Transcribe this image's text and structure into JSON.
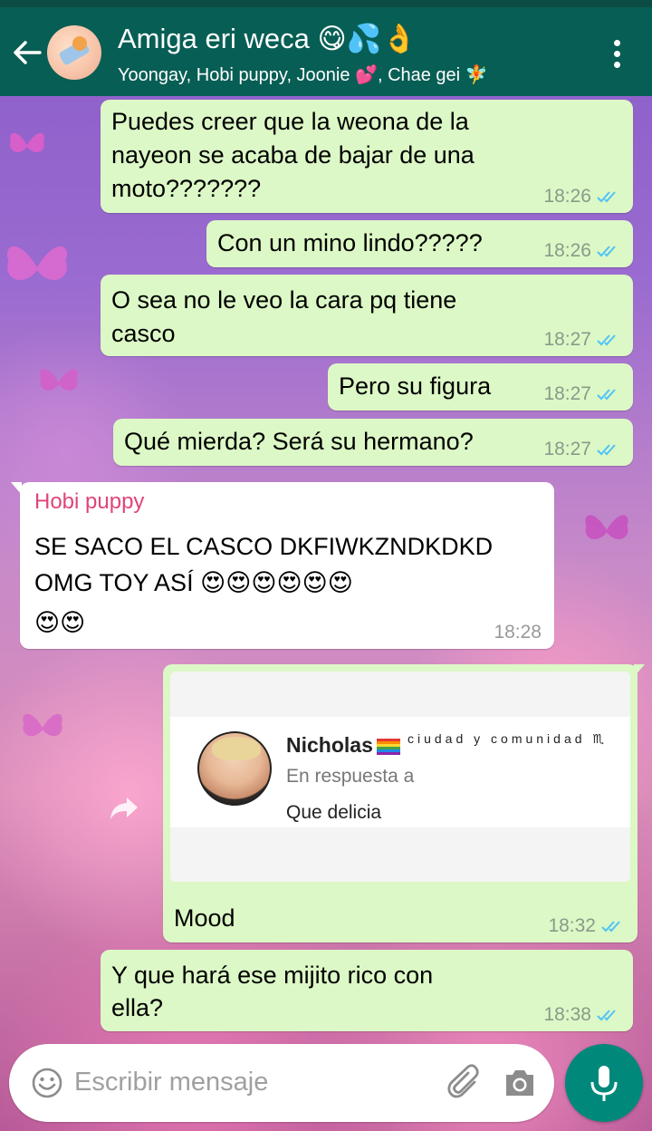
{
  "header": {
    "title": "Amiga eri weca 😋💦👌",
    "subtitle": "Yoongay, Hobi puppy, Joonie 💕, Chae gei 🧚"
  },
  "messages": [
    {
      "text": "Puedes creer que la weona de la",
      "text2": "nayeon se acaba de bajar de una",
      "text3": "moto???????",
      "time": "18:26"
    },
    {
      "text": "Con un mino lindo?????",
      "time": "18:26"
    },
    {
      "text": "O sea no le veo la cara pq tiene",
      "text2": "casco",
      "time": "18:27"
    },
    {
      "text": "Pero su figura",
      "time": "18:27"
    },
    {
      "text": "Qué mierda? Será su hermano?",
      "time": "18:27"
    },
    {
      "sender": "Hobi puppy",
      "text": "SE SACO EL CASCO DKFIWKZNDKDKD",
      "text2": "OMG TOY ASÍ 😍😍😍😍😍😍",
      "text3": "😍😍",
      "time": "18:28"
    },
    {
      "text": "Mood",
      "time": "18:32",
      "image": {
        "name": "Nicholas",
        "extra": "ciudad y comunidad ♏",
        "reply_label": "En respuesta a",
        "reply_text": "Que delicia"
      }
    },
    {
      "text": "Y que hará ese mijito rico con",
      "text2": "ella?",
      "time": "18:38"
    }
  ],
  "input": {
    "placeholder": "Escribir mensaje"
  },
  "colors": {
    "header": "#075e54",
    "outgoing_bubble": "#dcf8c6",
    "incoming_bubble": "#ffffff",
    "read_ticks": "#4fc3f7",
    "sender_name": "#e0447a",
    "mic_button": "#00897b"
  },
  "icons": [
    "back-arrow-icon",
    "more-vert-icon",
    "double-check-icon",
    "share-icon",
    "emoji-icon",
    "paperclip-icon",
    "camera-icon",
    "mic-icon"
  ]
}
